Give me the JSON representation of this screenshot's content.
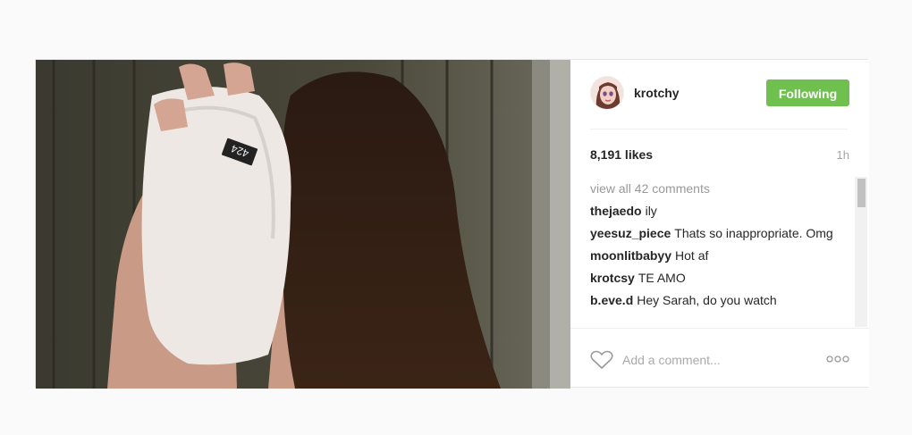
{
  "post": {
    "username": "krotchy",
    "follow_label": "Following",
    "likes": "8,191 likes",
    "time_ago": "1h",
    "view_all": "view all 42 comments",
    "image_label": "424",
    "comments": [
      {
        "user": "thejaedo",
        "text": "ily"
      },
      {
        "user": "yeesuz_piece",
        "text": "Thats so inappropriate. Omg"
      },
      {
        "user": "moonlitbabyy",
        "text": "Hot af"
      },
      {
        "user": "krotcsy",
        "text": "TE AMO"
      },
      {
        "user": "b.eve.d",
        "text": "Hey Sarah, do you watch"
      }
    ],
    "add_comment_placeholder": "Add a comment..."
  },
  "colors": {
    "follow_button": "#70c050",
    "background": "#fafafa"
  },
  "icons": {
    "like": "heart-icon",
    "more": "more-options-icon"
  }
}
